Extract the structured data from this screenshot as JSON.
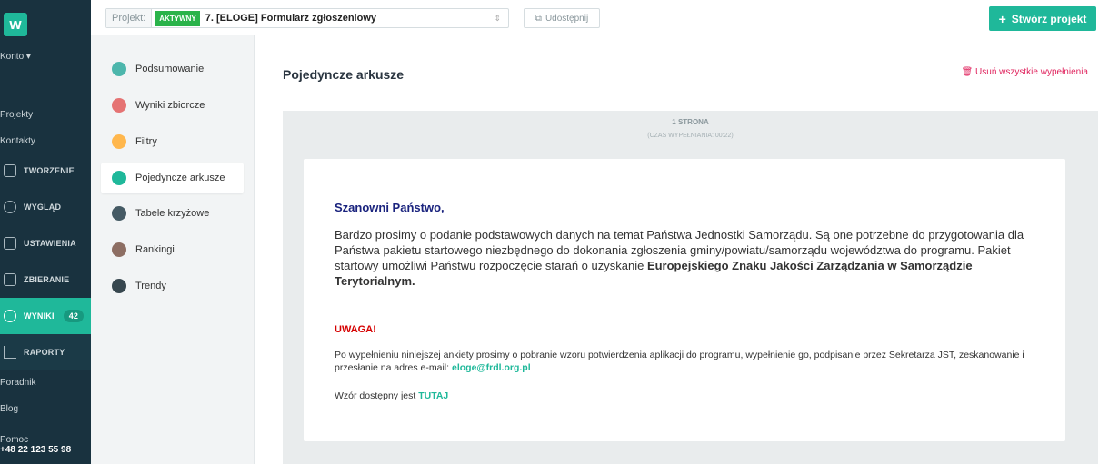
{
  "sidebar": {
    "logo": "w",
    "account": "Konto",
    "links": [
      "Projekty",
      "Kontakty"
    ],
    "sections": [
      {
        "label": "TWORZENIE",
        "icon": "clipboard-icon"
      },
      {
        "label": "WYGLĄD",
        "icon": "palette-icon"
      },
      {
        "label": "USTAWIENIA",
        "icon": "settings-icon"
      },
      {
        "label": "ZBIERANIE",
        "icon": "share-icon"
      },
      {
        "label": "WYNIKI",
        "icon": "results-icon",
        "badge": "42"
      },
      {
        "label": "RAPORTY",
        "icon": "chart-icon"
      }
    ],
    "bottom_links": [
      "Poradnik",
      "Blog"
    ],
    "help_label": "Pomoc",
    "help_phone": "+48 22 123 55 98"
  },
  "topbar": {
    "project_label": "Projekt:",
    "status": "AKTYWNY",
    "project_name": "7. [ELOGE] Formularz zgłoszeniowy",
    "share_label": "Udostępnij",
    "create_label": "Stwórz projekt"
  },
  "subnav": {
    "items": [
      {
        "label": "Podsumowanie",
        "color": "#4db6ac"
      },
      {
        "label": "Wyniki zbiorcze",
        "color": "#e57373"
      },
      {
        "label": "Filtry",
        "color": "#ffb74d"
      },
      {
        "label": "Pojedyncze arkusze",
        "color": "#1fb89a"
      },
      {
        "label": "Tabele krzyżowe",
        "color": "#455a64"
      },
      {
        "label": "Rankingi",
        "color": "#8d6e63"
      },
      {
        "label": "Trendy",
        "color": "#37474f"
      }
    ]
  },
  "main": {
    "title": "Pojedyncze arkusze",
    "delete_all": "Usuń wszystkie wypełnienia",
    "page_label": "1 STRONA",
    "fill_time": "(CZAS WYPEŁNIANIA: 00:22)",
    "greeting": "Szanowni Państwo,",
    "paragraph1": "Bardzo prosimy o podanie podstawowych danych na temat Państwa Jednostki Samorządu. Są one potrzebne do przygotowania dla Państwa pakietu startowego niezbędnego do dokonania zgłoszenia gminy/powiatu/samorządu województwa do programu. Pakiet startowy umożliwi Państwu rozpoczęcie starań o uzyskanie",
    "paragraph1_bold": "Europejskiego Znaku Jakości Zarządzania w Samorządzie Terytorialnym.",
    "warning": "UWAGA!",
    "paragraph2": "Po wypełnieniu niniejszej ankiety prosimy o pobranie wzoru potwierdzenia aplikacji do programu, wypełnienie go, podpisanie przez Sekretarza JST, zeskanowanie i przesłanie na adres e-mail:",
    "email": "eloge@frdl.org.pl",
    "template_text": "Wzór dostępny jest",
    "template_link": "TUTAJ"
  }
}
